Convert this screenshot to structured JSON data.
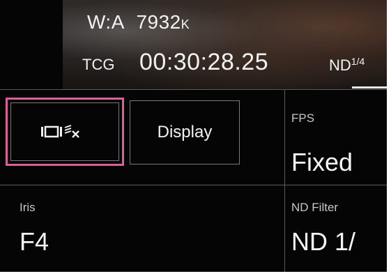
{
  "status": {
    "white_balance_prefix": "W:A",
    "white_balance_value": "7932",
    "white_balance_unit": "K",
    "timecode_label": "TCG",
    "timecode_value": "00:30:28.25",
    "nd_label": "ND",
    "nd_fraction": "1/4"
  },
  "buttons": {
    "display_toggle_icon": "display-off-icon",
    "display_label": "Display"
  },
  "cells": {
    "fps": {
      "label": "FPS",
      "value": "Fixed"
    },
    "iris": {
      "label": "Iris",
      "value": "F4"
    },
    "nd_filter": {
      "label": "ND Filter",
      "value": "ND 1/"
    }
  },
  "colors": {
    "background": "#050505",
    "selected_border": "#d9609a",
    "text": "#f2f2f2"
  }
}
